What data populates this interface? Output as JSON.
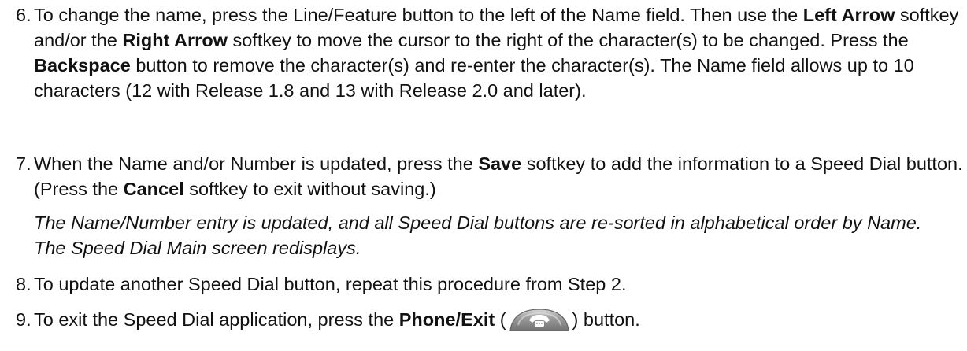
{
  "steps": [
    {
      "number": "6.",
      "parts": [
        "To change the name, press the Line/Feature button to the left of the Name field. Then use the ",
        "Left Arrow",
        " softkey and/or the ",
        "Right Arrow",
        " softkey to move the cursor to the right of the character(s) to be changed. Press the ",
        "Backspace",
        " button to remove the character(s) and re-enter the character(s). The Name field allows up to 10 characters (12 with Release 1.8 and 13 with Release 2.0 and later)."
      ]
    },
    {
      "number": "7.",
      "parts": [
        "When the Name and/or Number is updated, press the ",
        "Save",
        " softkey to add the information to a Speed Dial button. (Press the ",
        "Cancel",
        " softkey to exit without saving.)"
      ],
      "result": "The Name/Number entry is updated, and all Speed Dial buttons are re-sorted in alphabetical order by Name. The Speed Dial Main screen redisplays."
    },
    {
      "number": "8.",
      "text": "To update another Speed Dial button, repeat this procedure from Step 2."
    },
    {
      "number": "9.",
      "parts": [
        "To exit the Speed Dial application, press the ",
        "Phone/Exit",
        " (",
        ") button."
      ],
      "icon": "phone-exit-icon"
    }
  ],
  "colors": {
    "text": "#111111",
    "icon_fill": "#8a8a8a",
    "icon_highlight": "#d6d6d6",
    "icon_glyph": "#ffffff"
  }
}
